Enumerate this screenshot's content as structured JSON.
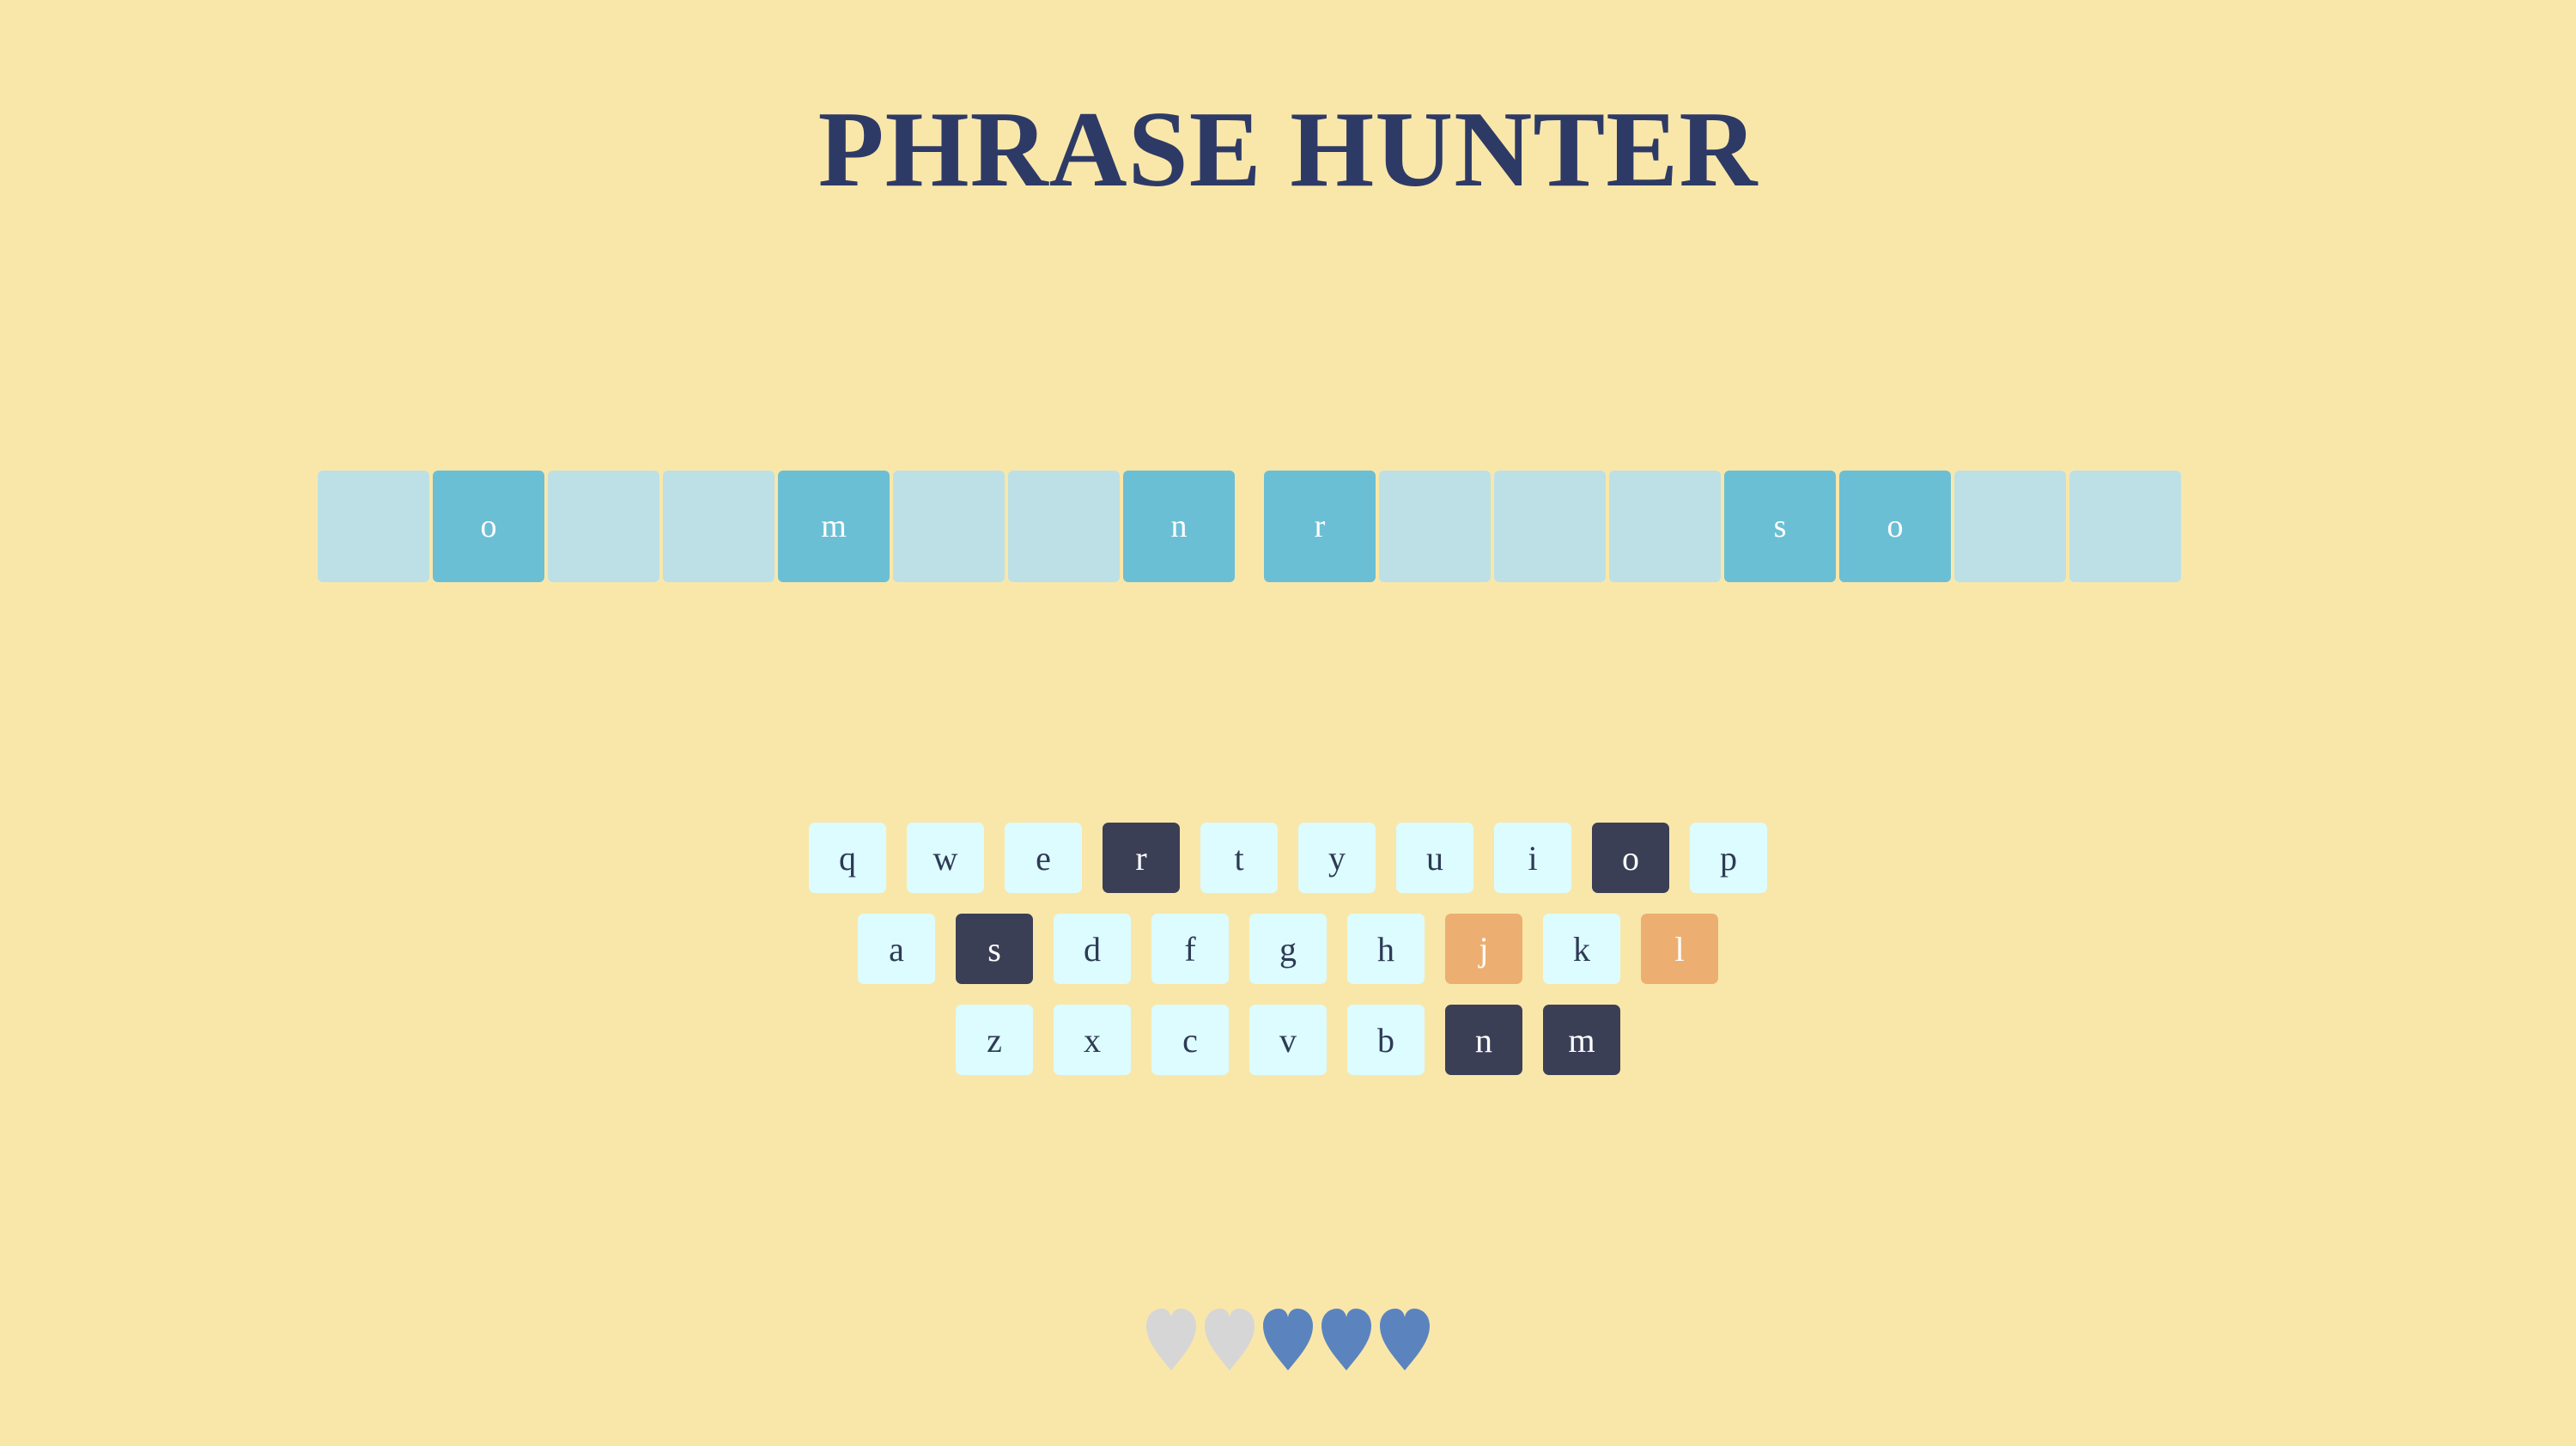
{
  "header": {
    "title": "PHRASE HUNTER"
  },
  "phrase": {
    "words": [
      [
        {
          "letter": "",
          "revealed": false
        },
        {
          "letter": "o",
          "revealed": true
        },
        {
          "letter": "",
          "revealed": false
        },
        {
          "letter": "",
          "revealed": false
        },
        {
          "letter": "m",
          "revealed": true
        },
        {
          "letter": "",
          "revealed": false
        },
        {
          "letter": "",
          "revealed": false
        },
        {
          "letter": "n",
          "revealed": true
        }
      ],
      [
        {
          "letter": "r",
          "revealed": true
        },
        {
          "letter": "",
          "revealed": false
        },
        {
          "letter": "",
          "revealed": false
        },
        {
          "letter": "",
          "revealed": false
        },
        {
          "letter": "s",
          "revealed": true
        },
        {
          "letter": "o",
          "revealed": true
        },
        {
          "letter": "",
          "revealed": false
        },
        {
          "letter": "",
          "revealed": false
        }
      ]
    ]
  },
  "keyboard": {
    "rows": [
      [
        {
          "key": "q",
          "state": "unused"
        },
        {
          "key": "w",
          "state": "unused"
        },
        {
          "key": "e",
          "state": "unused"
        },
        {
          "key": "r",
          "state": "chosen"
        },
        {
          "key": "t",
          "state": "unused"
        },
        {
          "key": "y",
          "state": "unused"
        },
        {
          "key": "u",
          "state": "unused"
        },
        {
          "key": "i",
          "state": "unused"
        },
        {
          "key": "o",
          "state": "chosen"
        },
        {
          "key": "p",
          "state": "unused"
        }
      ],
      [
        {
          "key": "a",
          "state": "unused"
        },
        {
          "key": "s",
          "state": "chosen"
        },
        {
          "key": "d",
          "state": "unused"
        },
        {
          "key": "f",
          "state": "unused"
        },
        {
          "key": "g",
          "state": "unused"
        },
        {
          "key": "h",
          "state": "unused"
        },
        {
          "key": "j",
          "state": "wrong"
        },
        {
          "key": "k",
          "state": "unused"
        },
        {
          "key": "l",
          "state": "wrong"
        }
      ],
      [
        {
          "key": "z",
          "state": "unused"
        },
        {
          "key": "x",
          "state": "unused"
        },
        {
          "key": "c",
          "state": "unused"
        },
        {
          "key": "v",
          "state": "unused"
        },
        {
          "key": "b",
          "state": "unused"
        },
        {
          "key": "n",
          "state": "chosen"
        },
        {
          "key": "m",
          "state": "chosen"
        }
      ]
    ]
  },
  "lives": {
    "total": 5,
    "remaining": 3,
    "icons": [
      "heart-lost-icon",
      "heart-lost-icon",
      "heart-live-icon",
      "heart-live-icon",
      "heart-live-icon"
    ]
  },
  "colors": {
    "background": "#f9e7aa",
    "title": "#2e3a66",
    "tile_hidden": "#bde0e6",
    "tile_revealed": "#6bbfd5",
    "key_default": "#dcfcff",
    "key_chosen": "#3b3f56",
    "key_wrong": "#ecaf71",
    "heart_live": "#5b84bf",
    "heart_lost": "#d6d6d6"
  }
}
